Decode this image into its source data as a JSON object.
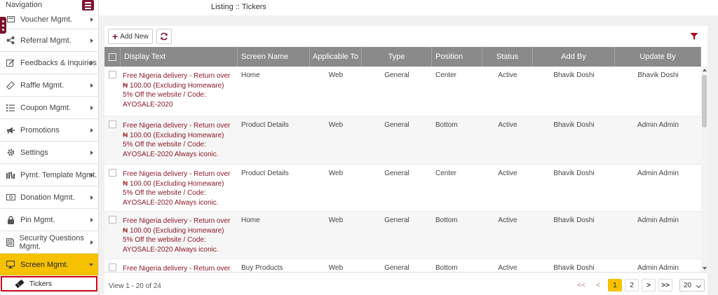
{
  "nav": {
    "title": "Navigation",
    "items": [
      {
        "label": "Voucher Mgmt.",
        "icon": "voucher-icon"
      },
      {
        "label": "Referral Mgmt.",
        "icon": "share-icon"
      },
      {
        "label": "Feedbacks & Inquiries",
        "icon": "edit-icon"
      },
      {
        "label": "Raffle Mgmt.",
        "icon": "ticket-icon"
      },
      {
        "label": "Coupon Mgmt.",
        "icon": "list-icon"
      },
      {
        "label": "Promotions",
        "icon": "megaphone-icon"
      },
      {
        "label": "Settings",
        "icon": "gear-icon"
      },
      {
        "label": "Pymt. Template Mgmt.",
        "icon": "bank-icon"
      },
      {
        "label": "Donation Mgmt.",
        "icon": "money-icon"
      },
      {
        "label": "Pin Mgmt.",
        "icon": "lock-icon"
      },
      {
        "label": "Security Questions Mgmt.",
        "icon": "document-icon"
      },
      {
        "label": "Screen Mgmt.",
        "icon": "monitor-icon"
      }
    ],
    "sub_item": "Tickers"
  },
  "breadcrumb": "Listing :: Tickers",
  "toolbar": {
    "add_label": "Add New"
  },
  "table": {
    "headers": [
      "Display Text",
      "Screen Name",
      "Applicable To",
      "Type",
      "Position",
      "Status",
      "Add By",
      "Update By"
    ],
    "rows": [
      {
        "display": "Free Nigeria delivery - Return over ₦ 100.00 (Excluding Homeware) 5% Off the website / Code: AYOSALE-2020",
        "screen": "Home",
        "applicable": "Web",
        "type": "General",
        "position": "Center",
        "status": "Active",
        "add_by": "Bhavik Doshi",
        "update_by": "Bhavik Doshi"
      },
      {
        "display": "Free Nigeria delivery - Return over ₦ 100.00 (Excluding Homeware) 5% Off the website / Code: AYOSALE-2020 Always iconic.",
        "screen": "Product Details",
        "applicable": "Web",
        "type": "General",
        "position": "Bottom",
        "status": "Active",
        "add_by": "Bhavik Doshi",
        "update_by": "Admin Admin"
      },
      {
        "display": "Free Nigeria delivery - Return over ₦ 100.00 (Excluding Homeware) 5% Off the website / Code: AYOSALE-2020 Always iconic.",
        "screen": "Product Details",
        "applicable": "Web",
        "type": "General",
        "position": "Center",
        "status": "Active",
        "add_by": "Bhavik Doshi",
        "update_by": "Admin Admin"
      },
      {
        "display": "Free Nigeria delivery - Return over ₦ 100.00 (Excluding Homeware) 5% Off the website / Code: AYOSALE-2020 Always iconic.",
        "screen": "Home",
        "applicable": "Web",
        "type": "General",
        "position": "Bottom",
        "status": "Active",
        "add_by": "Bhavik Doshi",
        "update_by": "Admin Admin"
      },
      {
        "display": "Free Nigeria delivery - Return over ₦",
        "screen": "Buy Products",
        "applicable": "Web",
        "type": "General",
        "position": "Bottom",
        "status": "Active",
        "add_by": "Bhavik Doshi",
        "update_by": "Admin Admin"
      }
    ]
  },
  "footer": {
    "view_info": "View 1 - 20 of 24",
    "pager": {
      "first": "<<",
      "prev": "<",
      "page1": "1",
      "page2": "2",
      "next": ">",
      "last": ">>"
    },
    "per_page": "20"
  },
  "colors": {
    "brand": "#7a1230",
    "accent": "#f6c200",
    "header_bg": "#8a8a8a",
    "display_text": "#8b1a2a"
  }
}
